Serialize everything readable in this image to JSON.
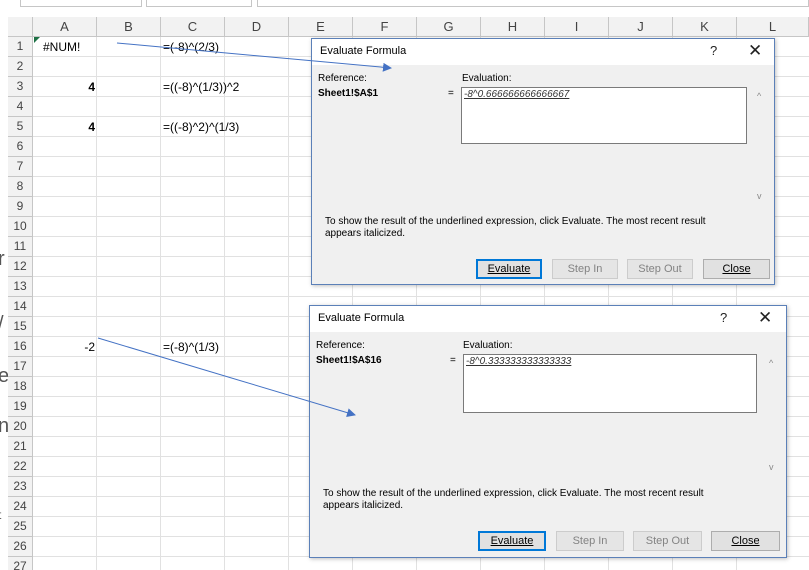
{
  "columns": [
    "A",
    "B",
    "C",
    "D",
    "E",
    "F",
    "G",
    "H",
    "I",
    "J",
    "K",
    "L"
  ],
  "rows": [
    "1",
    "2",
    "3",
    "4",
    "5",
    "6",
    "7",
    "8",
    "9",
    "10",
    "11",
    "12",
    "13",
    "14",
    "15",
    "16",
    "17",
    "18",
    "19",
    "20",
    "21",
    "22",
    "23",
    "24",
    "25",
    "26",
    "27"
  ],
  "cells": {
    "a1": "#NUM!",
    "c1": "=(-8)^(2/3)",
    "a3": "4",
    "c3": "=((-8)^(1/3))^2",
    "a5": "4",
    "c5": "=((-8)^2)^(1/3)",
    "a16": "-2",
    "c16": "=(-8)^(1/3)"
  },
  "dialog1": {
    "title": "Evaluate Formula",
    "help": "?",
    "close_icon": "✕",
    "reference_label": "Reference:",
    "reference_value": "Sheet1!$A$1",
    "equals": "=",
    "evaluation_label": "Evaluation:",
    "evaluation_value": "-8^0.666666666666667",
    "hint_line1": "To show the result of the underlined expression, click Evaluate.  The most recent result",
    "hint_line2": "appears italicized.",
    "evaluate_label": "Evaluate",
    "step_in_label": "Step In",
    "step_out_label": "Step Out",
    "close_label": "Close"
  },
  "dialog2": {
    "title": "Evaluate Formula",
    "help": "?",
    "close_icon": "✕",
    "reference_label": "Reference:",
    "reference_value": "Sheet1!$A$16",
    "equals": "=",
    "evaluation_label": "Evaluation:",
    "evaluation_value": "-8^0.333333333333333",
    "hint_line1": "To show the result of the underlined expression, click Evaluate.  The most recent result",
    "hint_line2": "appears italicized.",
    "evaluate_label": "Evaluate",
    "step_in_label": "Step In",
    "step_out_label": "Step Out",
    "close_label": "Close"
  },
  "colors": {
    "arrow": "#4472c4",
    "dialog_border": "#5b80b8",
    "primary_button_border": "#0078d7",
    "error_indicator": "#1e7145"
  }
}
